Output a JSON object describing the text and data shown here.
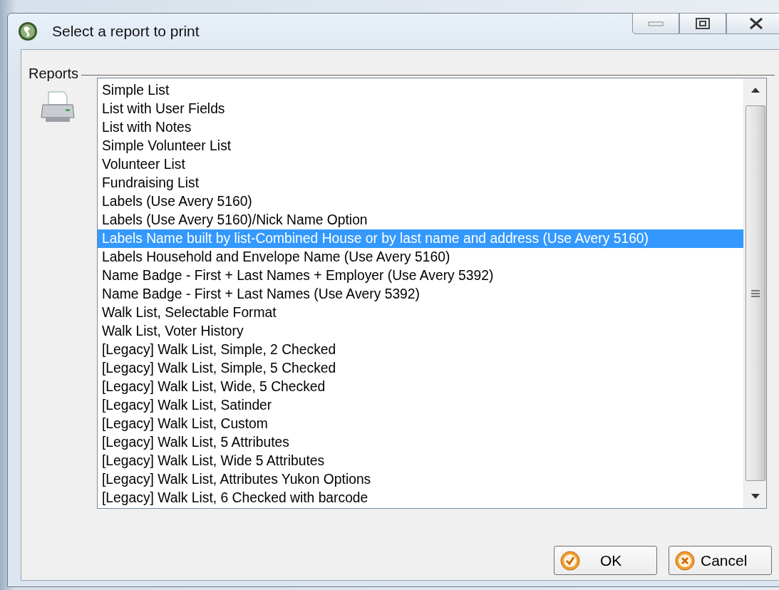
{
  "window": {
    "title": "Select a report to print"
  },
  "reports": {
    "label": "Reports",
    "items": [
      {
        "label": "Simple List",
        "selected": false
      },
      {
        "label": "List with User Fields",
        "selected": false
      },
      {
        "label": "List with Notes",
        "selected": false
      },
      {
        "label": "Simple Volunteer List",
        "selected": false
      },
      {
        "label": "Volunteer List",
        "selected": false
      },
      {
        "label": "Fundraising List",
        "selected": false
      },
      {
        "label": "Labels (Use Avery 5160)",
        "selected": false
      },
      {
        "label": "Labels (Use Avery 5160)/Nick Name Option",
        "selected": false
      },
      {
        "label": "Labels Name built by list-Combined House or by last name and address (Use Avery 5160)",
        "selected": true
      },
      {
        "label": "Labels Household and Envelope Name (Use Avery 5160)",
        "selected": false
      },
      {
        "label": "Name Badge - First + Last Names + Employer (Use Avery 5392)",
        "selected": false
      },
      {
        "label": "Name Badge - First + Last Names (Use Avery 5392)",
        "selected": false
      },
      {
        "label": "Walk List, Selectable Format",
        "selected": false
      },
      {
        "label": "Walk List, Voter History",
        "selected": false
      },
      {
        "label": "[Legacy] Walk List, Simple, 2 Checked",
        "selected": false
      },
      {
        "label": "[Legacy] Walk List, Simple, 5 Checked",
        "selected": false
      },
      {
        "label": "[Legacy] Walk List, Wide, 5 Checked",
        "selected": false
      },
      {
        "label": "[Legacy] Walk List, Satinder",
        "selected": false
      },
      {
        "label": "[Legacy] Walk List, Custom",
        "selected": false
      },
      {
        "label": "[Legacy] Walk List, 5 Attributes",
        "selected": false
      },
      {
        "label": "[Legacy] Walk List, Wide 5 Attributes",
        "selected": false
      },
      {
        "label": "[Legacy] Walk List, Attributes Yukon Options",
        "selected": false
      },
      {
        "label": "[Legacy] Walk List, 6 Checked with barcode",
        "selected": false
      }
    ]
  },
  "buttons": [
    {
      "label": "OK",
      "kind": "ok"
    },
    {
      "label": "Cancel",
      "kind": "cancel"
    }
  ]
}
